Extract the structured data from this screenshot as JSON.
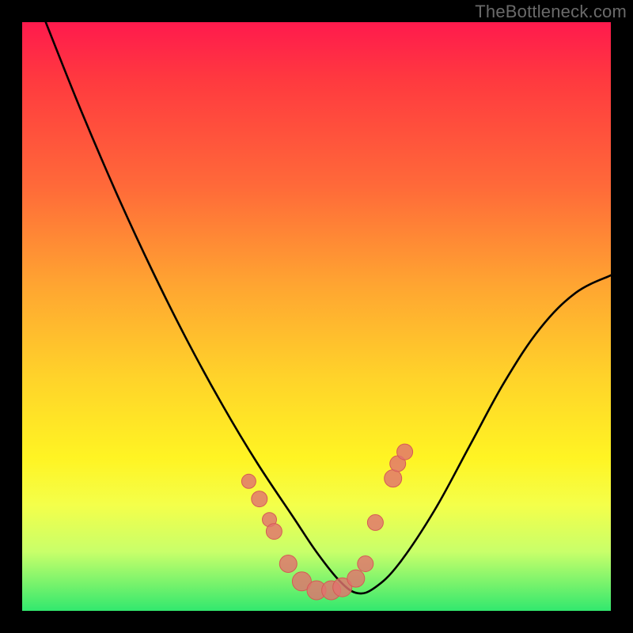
{
  "watermark": "TheBottleneck.com",
  "colors": {
    "frame": "#000000",
    "curve": "#000000",
    "dot_fill": "#e0736e",
    "dot_stroke": "#d55a55"
  },
  "chart_data": {
    "type": "line",
    "title": "",
    "xlabel": "",
    "ylabel": "",
    "xlim": [
      0,
      100
    ],
    "ylim": [
      0,
      100
    ],
    "grid": false,
    "legend": false,
    "note": "Values read off the curve: x is horizontal position as % of plot width (left→right), y is vertical position as % of plot height with 0 at bottom (green) and 100 at top (red). Curve minimum is near the bottom-center of the plot.",
    "series": [
      {
        "name": "curve",
        "x": [
          4,
          10,
          16,
          22,
          28,
          34,
          40,
          46,
          50,
          54,
          57,
          60,
          64,
          70,
          76,
          82,
          88,
          94,
          100
        ],
        "y": [
          100,
          85,
          71,
          58,
          46,
          35,
          25,
          16,
          10,
          5,
          3,
          4,
          8,
          17,
          28,
          39,
          48,
          54,
          57
        ]
      }
    ],
    "points": {
      "name": "dots",
      "note": "Scattered salmon-colored circular markers clustered near the bottom of the V, on both limbs.",
      "x": [
        38.5,
        40.3,
        42.0,
        42.8,
        45.2,
        47.5,
        50.0,
        52.5,
        54.4,
        56.7,
        58.3,
        60.0,
        63.0,
        63.8,
        65.0
      ],
      "y": [
        22.0,
        19.0,
        15.5,
        13.5,
        8.0,
        5.0,
        3.5,
        3.5,
        4.0,
        5.5,
        8.0,
        15.0,
        22.5,
        25.0,
        27.0
      ],
      "radius_px": [
        9,
        10,
        9,
        10,
        11,
        12,
        12,
        12,
        12,
        11,
        10,
        10,
        11,
        10,
        10
      ]
    }
  }
}
